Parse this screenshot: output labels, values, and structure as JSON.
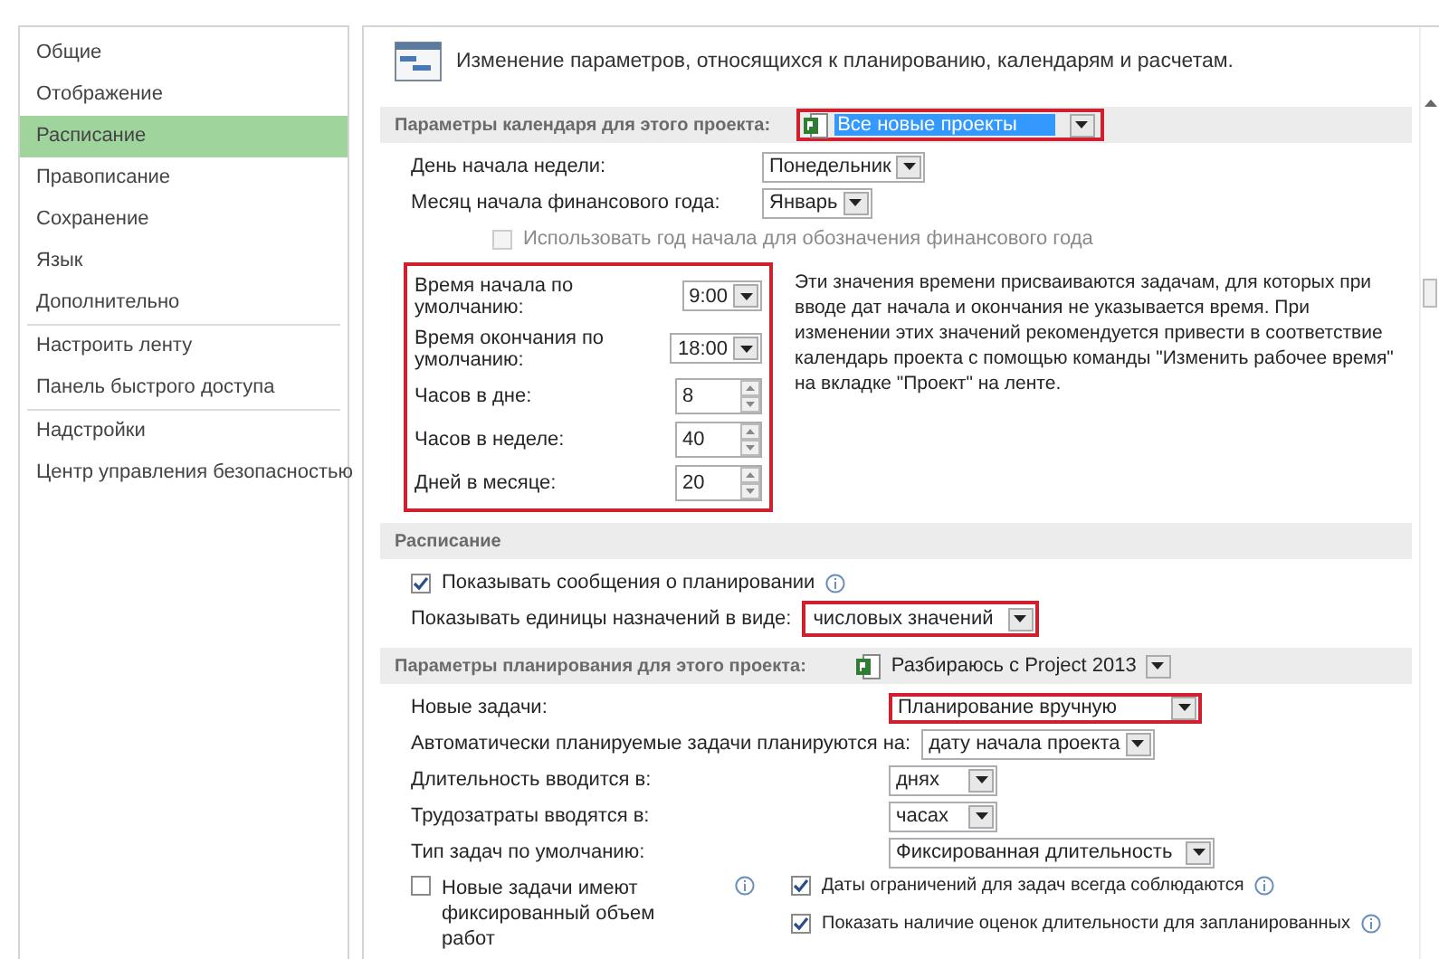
{
  "sidebar": {
    "groups": [
      [
        {
          "label": "Общие",
          "selected": false
        },
        {
          "label": "Отображение",
          "selected": false
        },
        {
          "label": "Расписание",
          "selected": true
        },
        {
          "label": "Правописание",
          "selected": false
        },
        {
          "label": "Сохранение",
          "selected": false
        },
        {
          "label": "Язык",
          "selected": false
        },
        {
          "label": "Дополнительно",
          "selected": false
        }
      ],
      [
        {
          "label": "Настроить ленту",
          "selected": false
        },
        {
          "label": "Панель быстрого доступа",
          "selected": false
        }
      ],
      [
        {
          "label": "Надстройки",
          "selected": false
        },
        {
          "label": "Центр управления безопасностью",
          "selected": false
        }
      ]
    ]
  },
  "header": {
    "text": "Изменение параметров, относящихся к планированию, календарям и расчетам."
  },
  "calendar_section": {
    "title": "Параметры календаря для этого проекта:",
    "project": {
      "value": "Все новые проекты",
      "text_selected": true,
      "highlighted": true
    }
  },
  "calendar_fields": [
    {
      "label": "День начала недели:",
      "value": "Понедельник"
    },
    {
      "label": "Месяц начала финансового года:",
      "value": "Январь"
    }
  ],
  "fiscal_checkbox": {
    "label": "Использовать год начала для обозначения финансового года",
    "checked": false,
    "disabled": true
  },
  "time_group": {
    "highlighted": true,
    "fields": [
      {
        "kind": "dropdown",
        "label": "Время начала по умолчанию:",
        "value": "9:00"
      },
      {
        "kind": "dropdown",
        "label": "Время окончания по умолчанию:",
        "value": "18:00"
      },
      {
        "kind": "spin",
        "label": "Часов в дне:",
        "value": "8"
      },
      {
        "kind": "spin",
        "label": "Часов в неделе:",
        "value": "40"
      },
      {
        "kind": "spin",
        "label": "Дней в месяце:",
        "value": "20"
      }
    ]
  },
  "time_note": "Эти значения времени присваиваются задачам, для которых при вводе дат начала и окончания не указывается время. При изменении этих значений рекомендуется привести в соответствие календарь проекта с помощью команды \"Изменить рабочее время\" на вкладке \"Проект\" на ленте.",
  "schedule_section": {
    "title": "Расписание",
    "show_messages": {
      "label": "Показывать сообщения о планировании",
      "checked": true
    },
    "units": {
      "label": "Показывать единицы назначений в виде:",
      "value": "числовых значений",
      "highlighted": true
    }
  },
  "planning_section": {
    "title": "Параметры планирования для этого проекта:",
    "project": {
      "value": "Разбираюсь с Project 2013",
      "text_selected": false,
      "highlighted": false
    }
  },
  "planning_fields": [
    {
      "label": "Новые задачи:",
      "value": "Планирование вручную",
      "highlighted": true
    },
    {
      "label": "Автоматически планируемые задачи планируются на:",
      "value": "дату начала проекта",
      "highlighted": false
    },
    {
      "label": "Длительность вводится в:",
      "value": "днях",
      "highlighted": false
    },
    {
      "label": "Трудозатраты вводятся в:",
      "value": "часах",
      "highlighted": false
    },
    {
      "label": "Тип задач по умолчанию:",
      "value": "Фиксированная длительность",
      "highlighted": false
    }
  ],
  "left_checkboxes": [
    {
      "label": "Новые задачи имеют фиксированный объем работ",
      "checked": false
    }
  ],
  "right_checkboxes": [
    {
      "label": "Даты ограничений для задач всегда соблюдаются",
      "checked": true
    },
    {
      "label": "Показать наличие оценок длительности для запланированных",
      "checked": true
    }
  ]
}
